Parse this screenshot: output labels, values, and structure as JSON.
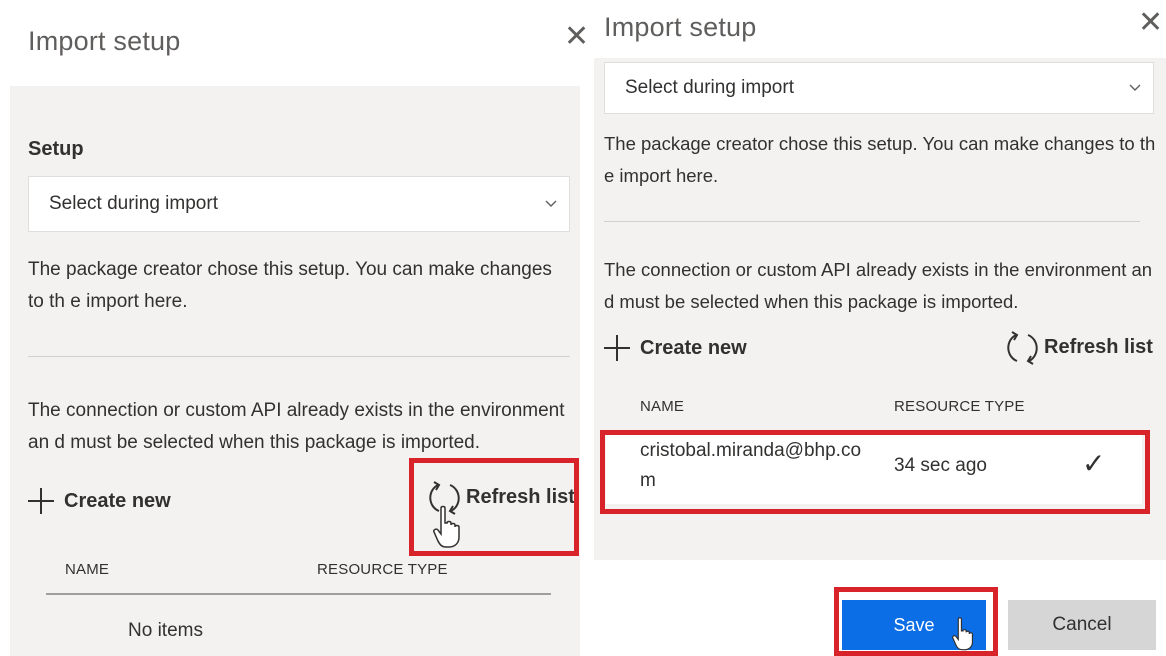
{
  "left_panel": {
    "title": "Import setup",
    "close_glyph": "✕",
    "setup_label": "Setup",
    "setup_dropdown_value": "Select during import",
    "note_setup": "The package creator chose this setup. You can make changes to th e import here.",
    "note_connection": "The connection or custom API already exists in the environment an d must be selected when this package is imported.",
    "create_new_label": "Create new",
    "refresh_label": "Refresh list",
    "columns": [
      "NAME",
      "RESOURCE TYPE"
    ],
    "empty_text": "No items"
  },
  "right_panel": {
    "title": "Import setup",
    "close_glyph": "✕",
    "setup_dropdown_value": "Select during import",
    "note_setup": "The package creator chose this setup. You can make changes to th e import here.",
    "note_connection": "The connection or custom API already exists in the environment an d must be selected when this package is imported.",
    "create_new_label": "Create new",
    "refresh_label": "Refresh list",
    "columns": [
      "NAME",
      "RESOURCE TYPE"
    ],
    "rows": [
      {
        "name": "cristobal.miranda@bhp.co m",
        "type": "34 sec ago",
        "selected_glyph": "✓"
      }
    ],
    "save_label": "Save",
    "cancel_label": "Cancel"
  },
  "colors": {
    "highlight": "#d8232a",
    "primary": "#0b6ee6",
    "gray_bg": "#f3f2f1"
  }
}
